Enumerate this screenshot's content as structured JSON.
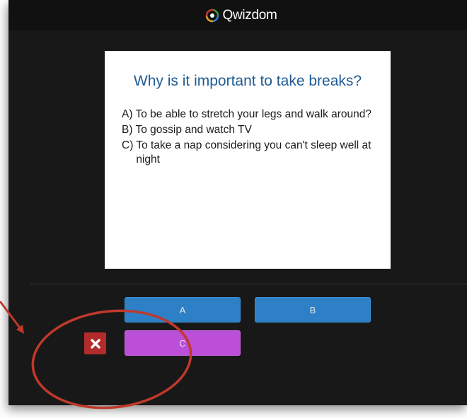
{
  "app": {
    "brand_name": "Qwizdom",
    "logo_icon": "qwizdom-swirl-icon"
  },
  "slide": {
    "question": "Why is it important to take breaks?",
    "choices": [
      {
        "letter": "A)",
        "text": "To be able to stretch your legs and walk around?"
      },
      {
        "letter": "B)",
        "text": "To gossip and watch TV"
      },
      {
        "letter": "C)",
        "text": "To take a nap considering you can't sleep well at night"
      }
    ]
  },
  "answers": {
    "a_label": "A",
    "b_label": "B",
    "c_label": "C",
    "remove_icon": "close-icon"
  },
  "colors": {
    "frame_bg": "#181818",
    "topbar_bg": "#111111",
    "question_text": "#1f5b95",
    "button_blue": "#2d7fc6",
    "button_purple": "#bb4fd8",
    "remove_red": "#b32b2b",
    "annotation_red": "#c0392b"
  }
}
